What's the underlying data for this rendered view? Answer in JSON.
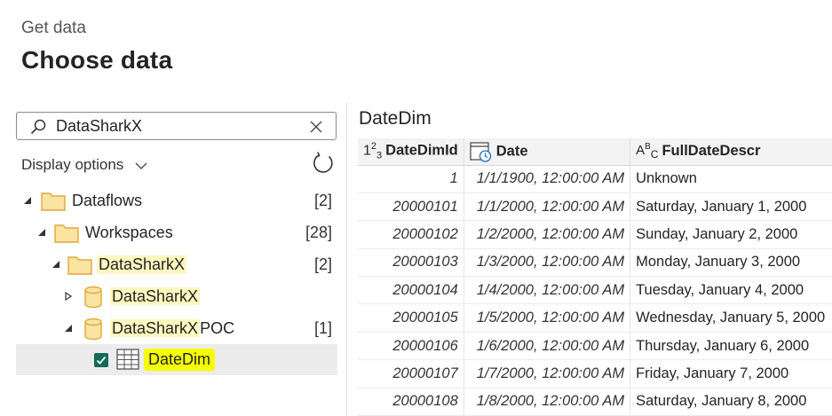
{
  "header": {
    "eyebrow": "Get data",
    "title": "Choose data"
  },
  "search": {
    "value": "DataSharkX",
    "placeholder": "Search"
  },
  "display_options": {
    "label": "Display options"
  },
  "tree": {
    "dataflows": {
      "label": "Dataflows",
      "count": "[2]"
    },
    "workspaces": {
      "label": "Workspaces",
      "count": "[28]"
    },
    "workspace_datasharkx": {
      "label": "DataSharkX",
      "count": "[2]"
    },
    "dataflow_datasharkx": {
      "label_highlight": "DataSharkX",
      "label_rest": ""
    },
    "dataflow_poc": {
      "label_highlight": "DataSharkX",
      "label_rest": "POC",
      "count": "[1]"
    },
    "table_datedim": {
      "label": "DateDim",
      "checked": true
    }
  },
  "preview": {
    "title": "DateDim",
    "columns": [
      {
        "type_icon": "number-type-icon",
        "name": "DateDimId"
      },
      {
        "type_icon": "datetime-type-icon",
        "name": "Date"
      },
      {
        "type_icon": "text-type-icon",
        "name": "FullDateDescr"
      }
    ],
    "rows": [
      [
        "1",
        "1/1/1900, 12:00:00 AM",
        "Unknown"
      ],
      [
        "20000101",
        "1/1/2000, 12:00:00 AM",
        "Saturday, January 1, 2000"
      ],
      [
        "20000102",
        "1/2/2000, 12:00:00 AM",
        "Sunday, January 2, 2000"
      ],
      [
        "20000103",
        "1/3/2000, 12:00:00 AM",
        "Monday, January 3, 2000"
      ],
      [
        "20000104",
        "1/4/2000, 12:00:00 AM",
        "Tuesday, January 4, 2000"
      ],
      [
        "20000105",
        "1/5/2000, 12:00:00 AM",
        "Wednesday, January 5, 2000"
      ],
      [
        "20000106",
        "1/6/2000, 12:00:00 AM",
        "Thursday, January 6, 2000"
      ],
      [
        "20000107",
        "1/7/2000, 12:00:00 AM",
        "Friday, January 7, 2000"
      ],
      [
        "20000108",
        "1/8/2000, 12:00:00 AM",
        "Saturday, January 8, 2000"
      ]
    ]
  },
  "colors": {
    "folder": "#f2c14e",
    "folder_fill": "#fbe3a1",
    "highlight": "#f5ff00",
    "checkbox": "#116b57"
  }
}
